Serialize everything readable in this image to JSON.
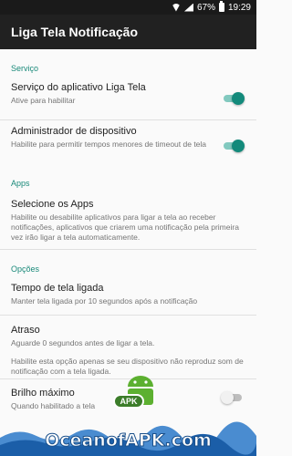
{
  "status_bar": {
    "battery": "67%",
    "time": "19:29"
  },
  "app_bar": {
    "title": "Liga Tela Notificação"
  },
  "sections": {
    "servico": {
      "header": "Serviço",
      "items": [
        {
          "title": "Serviço do aplicativo Liga Tela",
          "summary": "Ative para habilitar",
          "switch_on": true
        },
        {
          "title": "Administrador de dispositivo",
          "summary": "Habilite para permitir tempos menores de timeout de tela",
          "switch_on": true
        }
      ]
    },
    "apps": {
      "header": "Apps",
      "items": [
        {
          "title": "Selecione os Apps",
          "summary": "Habilite ou desabilite aplicativos para ligar a tela ao receber notificações, aplicativos que criarem uma notificação pela primeira vez irão ligar a tela automaticamente."
        }
      ]
    },
    "opcoes": {
      "header": "Opções",
      "items": [
        {
          "title": "Tempo de tela ligada",
          "summary": "Manter tela ligada por 10 segundos após a notificação"
        },
        {
          "title": "Atraso",
          "summary": "Aguarde 0 segundos antes de ligar a tela.",
          "summary2": "Habilite esta opção apenas se seu dispositivo não reproduz som de notificação com a tela ligada."
        },
        {
          "title": "Brilho máximo",
          "summary": "Quando habilitado a tela",
          "switch_on": false
        }
      ]
    }
  },
  "watermark": {
    "text": "OceanofAPK.com",
    "badge": "APK"
  },
  "colors": {
    "accent": "#138a7b",
    "app_bar": "#212121",
    "status_bar": "#1a1a1a"
  }
}
